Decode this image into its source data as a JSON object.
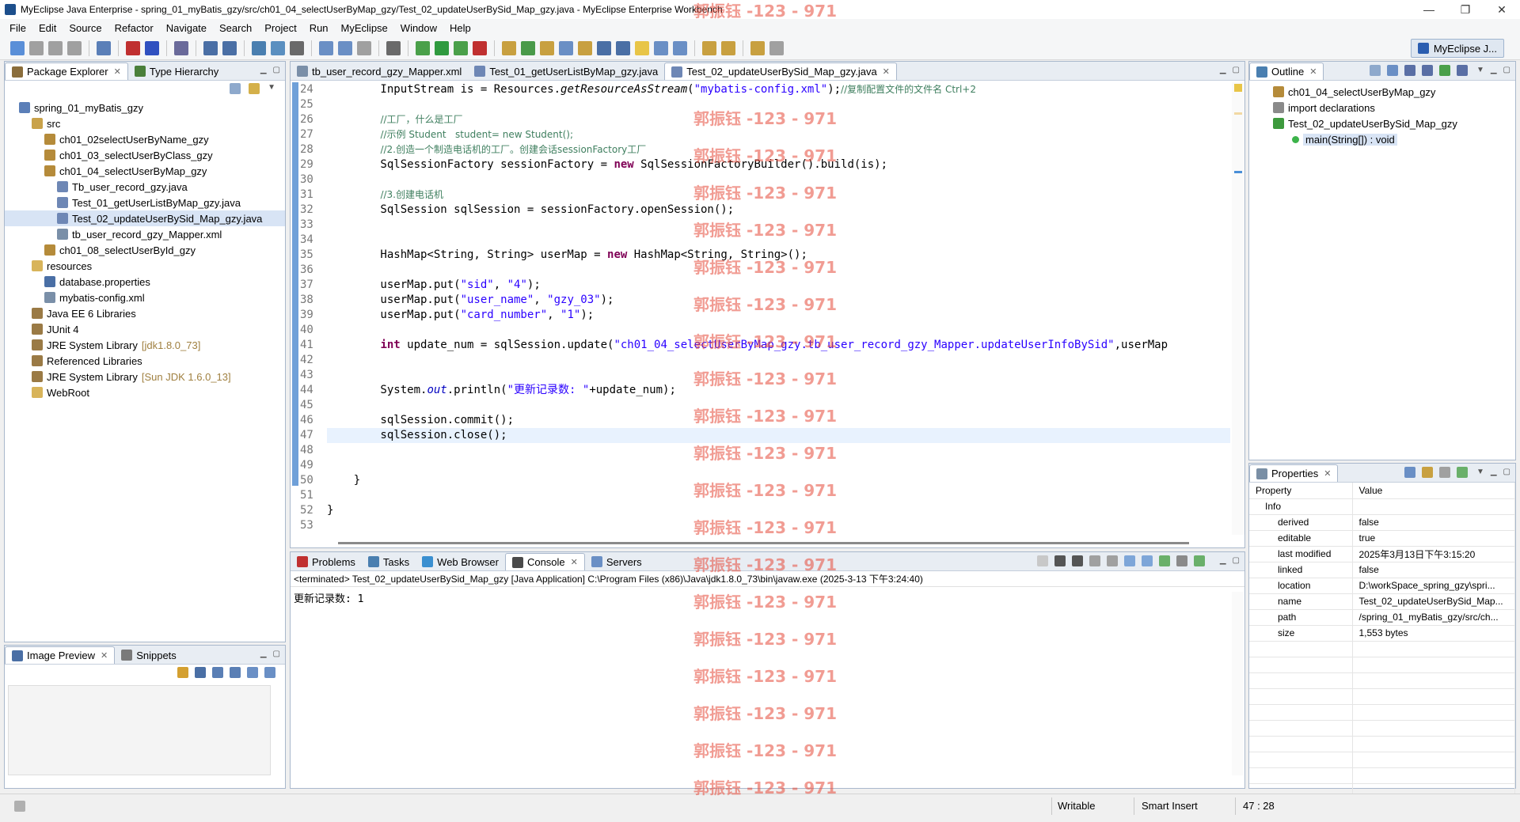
{
  "window": {
    "title": "MyEclipse Java Enterprise - spring_01_myBatis_gzy/src/ch01_04_selectUserByMap_gzy/Test_02_updateUserBySid_Map_gzy.java - MyEclipse Enterprise Workbench",
    "minimize": "—",
    "restore": "❐",
    "close": "✕"
  },
  "menu": [
    "File",
    "Edit",
    "Source",
    "Refactor",
    "Navigate",
    "Search",
    "Project",
    "Run",
    "MyEclipse",
    "Window",
    "Help"
  ],
  "perspective_label": "MyEclipse J...",
  "left_panel": {
    "tabs": [
      "Package Explorer",
      "Type Hierarchy"
    ],
    "tree": [
      {
        "label": "spring_01_myBatis_gzy",
        "indent": 0,
        "icon": "project-icon"
      },
      {
        "label": "src",
        "indent": 1,
        "icon": "source-folder-icon"
      },
      {
        "label": "ch01_02selectUserByName_gzy",
        "indent": 2,
        "icon": "package-icon"
      },
      {
        "label": "ch01_03_selectUserByClass_gzy",
        "indent": 2,
        "icon": "package-icon"
      },
      {
        "label": "ch01_04_selectUserByMap_gzy",
        "indent": 2,
        "icon": "package-icon"
      },
      {
        "label": "Tb_user_record_gzy.java",
        "indent": 3,
        "icon": "java-file-icon"
      },
      {
        "label": "Test_01_getUserListByMap_gzy.java",
        "indent": 3,
        "icon": "java-file-icon"
      },
      {
        "label": "Test_02_updateUserBySid_Map_gzy.java",
        "indent": 3,
        "icon": "java-file-icon",
        "selected": true
      },
      {
        "label": "tb_user_record_gzy_Mapper.xml",
        "indent": 3,
        "icon": "xml-file-icon"
      },
      {
        "label": "ch01_08_selectUserById_gzy",
        "indent": 2,
        "icon": "package-icon"
      },
      {
        "label": "resources",
        "indent": 1,
        "icon": "folder-icon"
      },
      {
        "label": "database.properties",
        "indent": 2,
        "icon": "properties-file-icon"
      },
      {
        "label": "mybatis-config.xml",
        "indent": 2,
        "icon": "xml-file-icon"
      },
      {
        "label": "Java EE 6 Libraries",
        "indent": 1,
        "icon": "library-icon"
      },
      {
        "label": "JUnit 4",
        "indent": 1,
        "icon": "library-icon"
      },
      {
        "label": "JRE System Library",
        "extra": "[jdk1.8.0_73]",
        "indent": 1,
        "icon": "library-icon"
      },
      {
        "label": "Referenced Libraries",
        "indent": 1,
        "icon": "library-icon"
      },
      {
        "label": "JRE System Library",
        "extra": "[Sun JDK 1.6.0_13]",
        "indent": 1,
        "icon": "library-icon"
      },
      {
        "label": "WebRoot",
        "indent": 1,
        "icon": "folder-icon"
      }
    ]
  },
  "image_panel": {
    "tabs": [
      "Image Preview",
      "Snippets"
    ]
  },
  "editor": {
    "tabs": [
      "tb_user_record_gzy_Mapper.xml",
      "Test_01_getUserListByMap_gzy.java",
      "Test_02_updateUserBySid_Map_gzy.java"
    ],
    "active_tab": 2,
    "lines": [
      {
        "n": "24",
        "html": "        InputStream is = Resources.<span class=\"it\">getResourceAsStream</span>(<span class=\"str\">\"mybatis-config.xml\"</span>);<span class=\"cm\">//复制配置文件的文件名 Ctrl+2</span>"
      },
      {
        "n": "25",
        "html": ""
      },
      {
        "n": "26",
        "html": "        <span class=\"cm\">//工厂，什么是工厂</span>"
      },
      {
        "n": "27",
        "html": "        <span class=\"cm\">//示例 Student   student= new Student();</span>"
      },
      {
        "n": "28",
        "html": "        <span class=\"cm\">//2.创造一个制造电话机的工厂。创建会话sessionFactory工厂</span>"
      },
      {
        "n": "29",
        "html": "        SqlSessionFactory sessionFactory = <span class=\"kw\">new</span> SqlSessionFactoryBuilder().build(is);"
      },
      {
        "n": "30",
        "html": ""
      },
      {
        "n": "31",
        "html": "        <span class=\"cm\">//3.创建电话机</span>"
      },
      {
        "n": "32",
        "html": "        SqlSession sqlSession = sessionFactory.openSession();"
      },
      {
        "n": "33",
        "html": ""
      },
      {
        "n": "34",
        "html": ""
      },
      {
        "n": "35",
        "html": "        HashMap&lt;String, String&gt; userMap = <span class=\"kw\">new</span> HashMap&lt;String, String&gt;();"
      },
      {
        "n": "36",
        "html": ""
      },
      {
        "n": "37",
        "html": "        userMap.put(<span class=\"str\">\"sid\"</span>, <span class=\"str\">\"4\"</span>);"
      },
      {
        "n": "38",
        "html": "        userMap.put(<span class=\"str\">\"user_name\"</span>, <span class=\"str\">\"gzy_03\"</span>);"
      },
      {
        "n": "39",
        "html": "        userMap.put(<span class=\"str\">\"card_number\"</span>, <span class=\"str\">\"1\"</span>);"
      },
      {
        "n": "40",
        "html": ""
      },
      {
        "n": "41",
        "html": "        <span class=\"kw\">int</span> update_num = sqlSession.update(<span class=\"str\">\"ch01_04_selectUserByMap_gzy.tb_user_record_gzy_Mapper.updateUserInfoBySid\"</span>,userMap"
      },
      {
        "n": "42",
        "html": ""
      },
      {
        "n": "43",
        "html": ""
      },
      {
        "n": "44",
        "html": "        System.<span class=\"it\" style=\"color:#0000c0\">out</span>.println(<span class=\"str\">\"更新记录数: \"</span>+update_num);"
      },
      {
        "n": "45",
        "html": ""
      },
      {
        "n": "46",
        "html": "        sqlSession.commit();"
      },
      {
        "n": "47",
        "html": "        sqlSession.close();",
        "current": true
      },
      {
        "n": "48",
        "html": ""
      },
      {
        "n": "49",
        "html": ""
      },
      {
        "n": "50",
        "html": "    }"
      },
      {
        "n": "51",
        "html": ""
      },
      {
        "n": "52",
        "html": "}"
      },
      {
        "n": "53",
        "html": ""
      }
    ]
  },
  "bottom_panel": {
    "tabs": [
      "Problems",
      "Tasks",
      "Web Browser",
      "Console",
      "Servers"
    ],
    "active_tab": 3,
    "terminated_line": "<terminated> Test_02_updateUserBySid_Map_gzy [Java Application] C:\\Program Files (x86)\\Java\\jdk1.8.0_73\\bin\\javaw.exe (2025-3-13 下午3:24:40)",
    "output": "更新记录数: 1"
  },
  "outline": {
    "tab": "Outline",
    "items": [
      {
        "label": "ch01_04_selectUserByMap_gzy",
        "indent": 0,
        "icon": "package-icon"
      },
      {
        "label": "import declarations",
        "indent": 0,
        "icon": "import-icon"
      },
      {
        "label": "Test_02_updateUserBySid_Map_gzy",
        "indent": 0,
        "icon": "class-icon"
      },
      {
        "label": "main(String[]) : void",
        "indent": 1,
        "icon": "method-icon",
        "selected": true
      }
    ]
  },
  "properties": {
    "tab": "Properties",
    "header": [
      "Property",
      "Value"
    ],
    "category": "Info",
    "rows": [
      [
        "derived",
        "false"
      ],
      [
        "editable",
        "true"
      ],
      [
        "last modified",
        "2025年3月13日下午3:15:20"
      ],
      [
        "linked",
        "false"
      ],
      [
        "location",
        "D:\\workSpace_spring_gzy\\spri..."
      ],
      [
        "name",
        "Test_02_updateUserBySid_Map..."
      ],
      [
        "path",
        "/spring_01_myBatis_gzy/src/ch..."
      ],
      [
        "size",
        "1,553  bytes"
      ]
    ]
  },
  "statusbar": {
    "writable": "Writable",
    "insert": "Smart Insert",
    "position": "47 : 28"
  },
  "watermark": "郭振钰 -123 - 971",
  "colors": {
    "accent": "#6fa0d8",
    "keyword": "#7f0055",
    "string": "#2a00ff",
    "comment": "#3f7f5f",
    "watermark": "#e74c3c"
  }
}
